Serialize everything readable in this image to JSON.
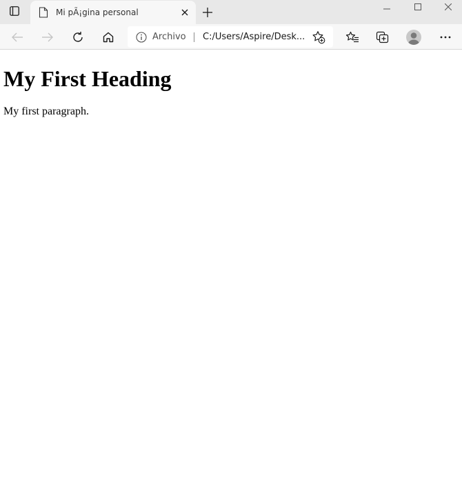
{
  "tabstrip": {
    "tab_actions_icon": "tab-actions-icon",
    "active_tab": {
      "title": "Mi pÃ¡gina personal",
      "favicon": "document-icon",
      "close_icon": "close-icon"
    },
    "new_tab_icon": "plus-icon",
    "window_controls": [
      "minimize-icon",
      "maximize-icon",
      "close-icon"
    ]
  },
  "toolbar": {
    "back_icon": "back-arrow-icon",
    "forward_icon": "forward-arrow-icon",
    "refresh_icon": "refresh-icon",
    "home_icon": "home-icon",
    "site_info_label": "Archivo",
    "url": "C:/Users/Aspire/Desk...",
    "add_favorite_icon": "star-add-icon",
    "favorites_icon": "favorites-icon",
    "collections_icon": "collections-icon",
    "profile_icon": "profile-avatar-icon",
    "more_icon": "more-icon"
  },
  "page": {
    "heading": "My First Heading",
    "paragraph": "My first paragraph."
  },
  "colors": {
    "tabstrip_bg": "#e8e8e8",
    "active_tab_bg": "#f7f7f7",
    "toolbar_bg": "#f7f7f7",
    "page_bg": "#ffffff"
  }
}
